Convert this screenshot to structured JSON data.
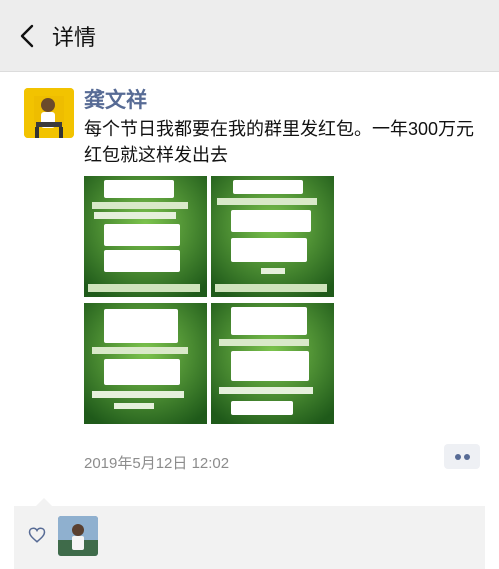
{
  "header": {
    "title": "详情"
  },
  "post": {
    "author": "龚文祥",
    "text": "每个节日我都要在我的群里发红包。一年300万元红包就这样发出去",
    "date": "2019年5月12日 12:02"
  },
  "images": [
    {
      "type": "chat-screenshot"
    },
    {
      "type": "chat-screenshot"
    },
    {
      "type": "chat-screenshot"
    },
    {
      "type": "chat-screenshot"
    }
  ],
  "colors": {
    "name": "#576b95",
    "date": "#8c8c8c",
    "header_bg": "#ededed"
  }
}
